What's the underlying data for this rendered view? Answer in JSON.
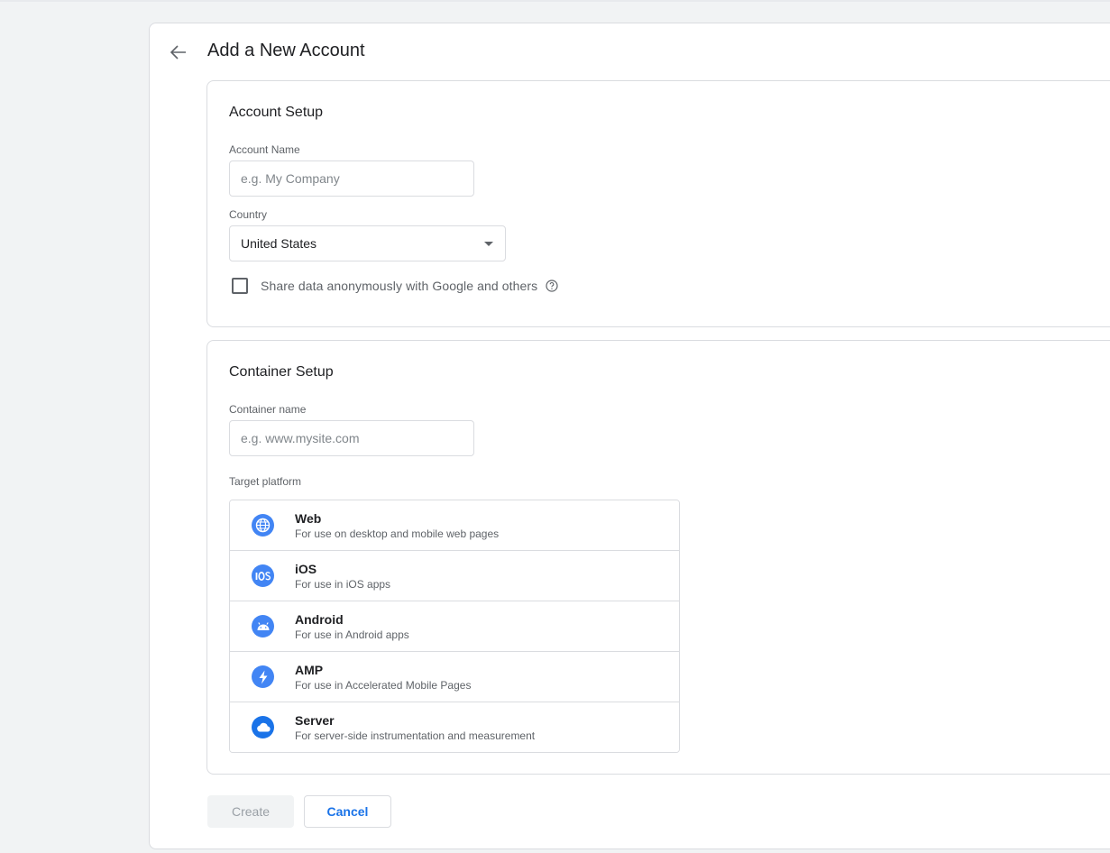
{
  "header": {
    "title": "Add a New Account",
    "back_icon": "arrow-back-icon"
  },
  "account_setup": {
    "title": "Account Setup",
    "account_name": {
      "label": "Account Name",
      "placeholder": "e.g. My Company",
      "value": ""
    },
    "country": {
      "label": "Country",
      "value": "United States"
    },
    "share_data": {
      "label": "Share data anonymously with Google and others",
      "checked": false
    }
  },
  "container_setup": {
    "title": "Container Setup",
    "container_name": {
      "label": "Container name",
      "placeholder": "e.g. www.mysite.com",
      "value": ""
    },
    "target_platform_label": "Target platform",
    "platforms": [
      {
        "name": "Web",
        "description": "For use on desktop and mobile web pages",
        "icon": "globe-icon"
      },
      {
        "name": "iOS",
        "description": "For use in iOS apps",
        "icon": "ios-icon"
      },
      {
        "name": "Android",
        "description": "For use in Android apps",
        "icon": "android-icon"
      },
      {
        "name": "AMP",
        "description": "For use in Accelerated Mobile Pages",
        "icon": "bolt-icon"
      },
      {
        "name": "Server",
        "description": "For server-side instrumentation and measurement",
        "icon": "cloud-icon"
      }
    ]
  },
  "actions": {
    "create_label": "Create",
    "cancel_label": "Cancel"
  },
  "colors": {
    "accent": "#1a73e8",
    "icon_blue": "#4285f4",
    "border": "#dadce0",
    "background": "#f1f3f4"
  }
}
